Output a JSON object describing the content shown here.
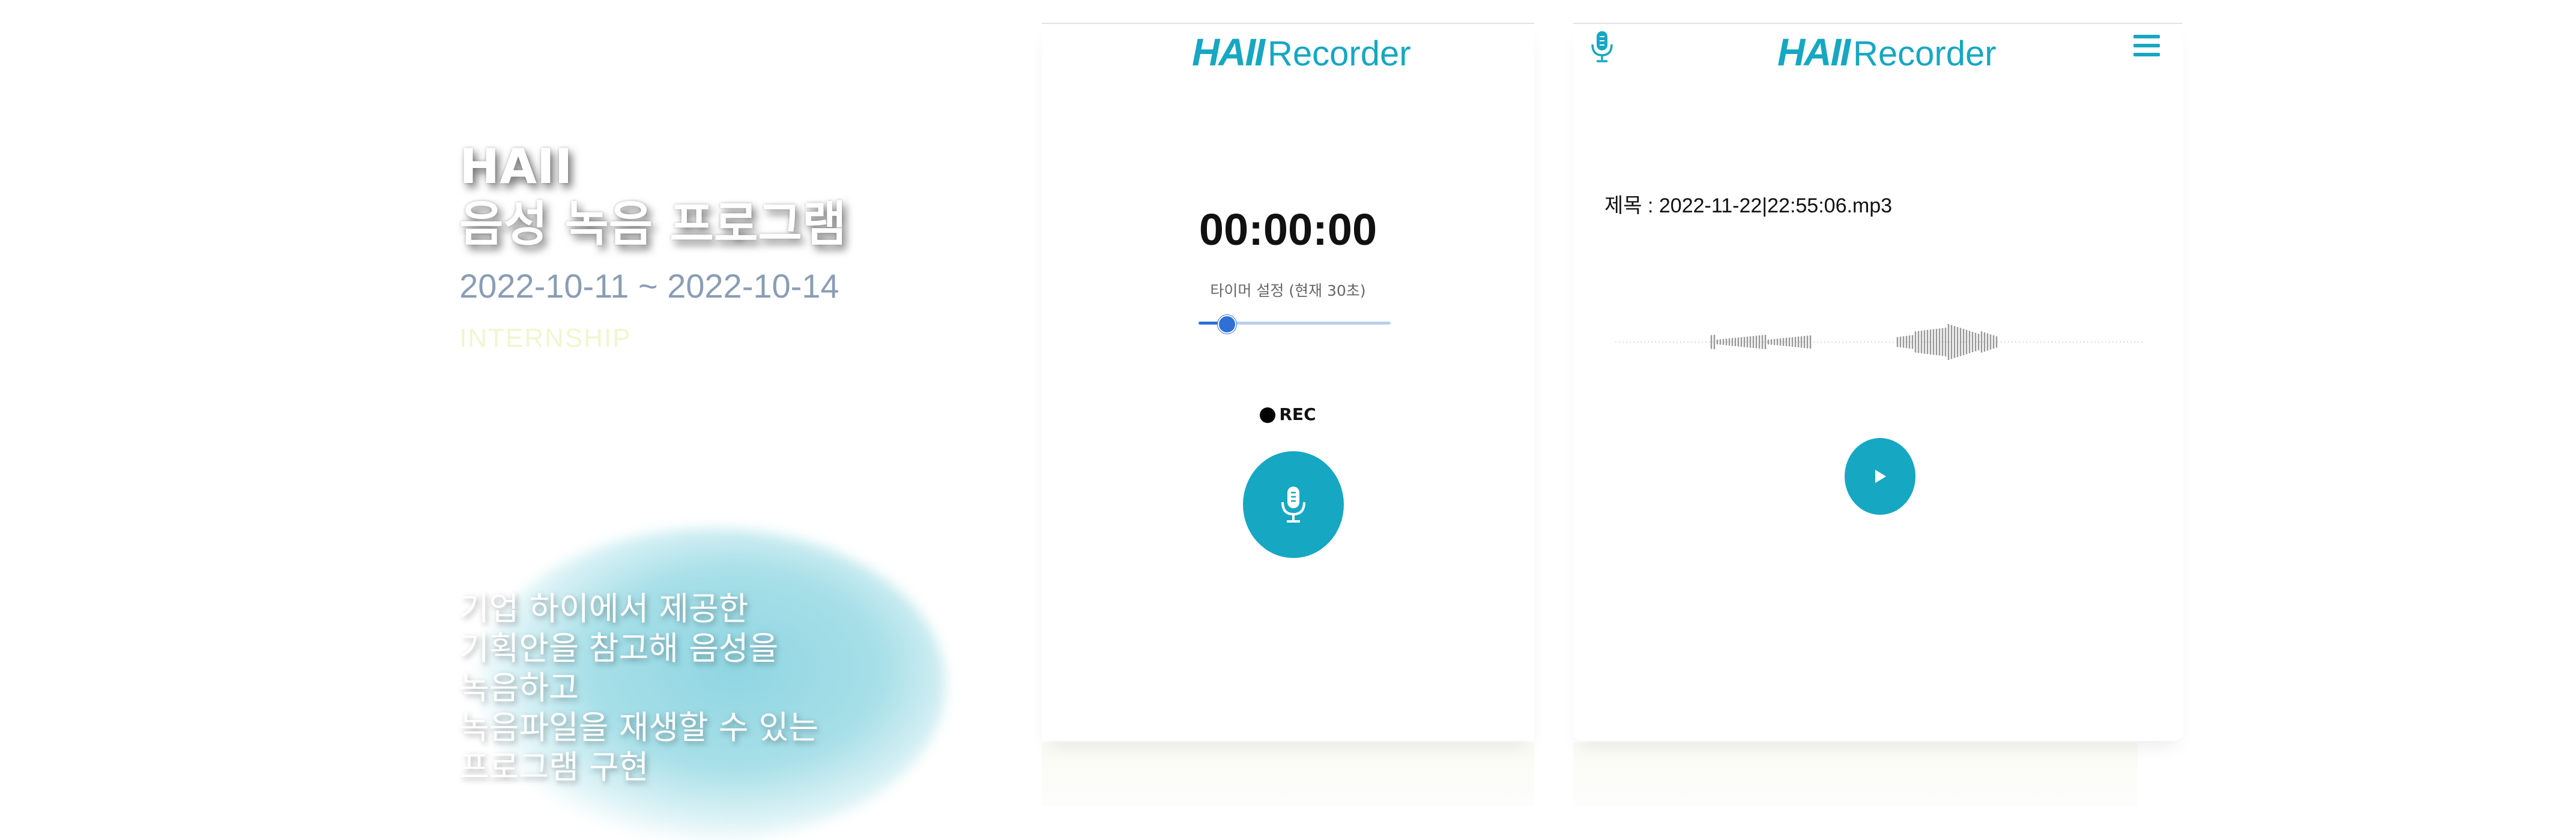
{
  "intro": {
    "title_lines": [
      "HAII",
      "음성 녹음 프로그램"
    ],
    "dates": "2022-10-11 ~ 2022-10-14",
    "tagline": "INTERNSHIP",
    "description_lines": [
      "기업 하이에서 제공한",
      "기획안을 참고해 음성을",
      "녹음하고",
      "녹음파일을 재생할 수 있는",
      "프로그램 구현"
    ]
  },
  "brand": {
    "mark": "HAII",
    "word": "Recorder",
    "accent_color": "#16a7c2"
  },
  "recorder": {
    "timer": "00:00:00",
    "timer_setting_label": "타이머 설정 (현재 30초)",
    "timer_slider_fraction": 0.14,
    "rec_label": "REC",
    "record_icon": "microphone-icon"
  },
  "player": {
    "top_icon": "microphone-icon",
    "menu_icon": "hamburger-menu-icon",
    "file_title": "제목 : 2022-11-22|22:55:06.mp3",
    "play_icon": "play-icon"
  }
}
